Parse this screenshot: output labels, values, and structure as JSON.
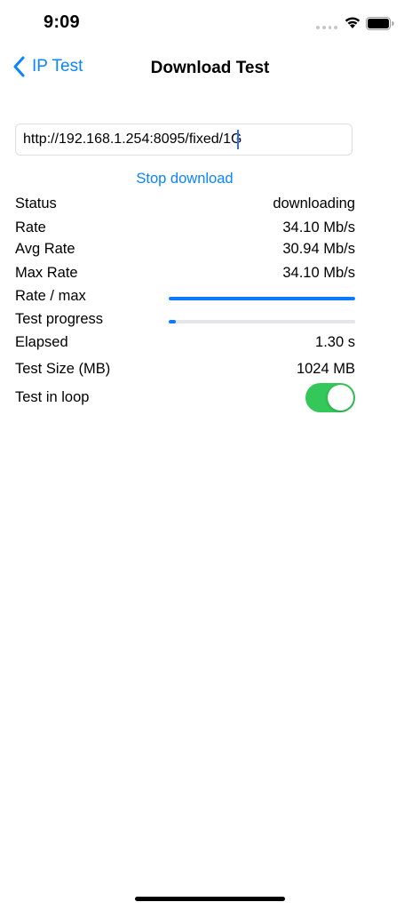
{
  "status_bar": {
    "time": "9:09",
    "icons": [
      "signal-icon",
      "wifi-icon",
      "battery-icon"
    ]
  },
  "nav": {
    "back_label": "IP Test",
    "title": "Download Test"
  },
  "url_field": {
    "value": "http://192.168.1.254:8095/fixed/1G"
  },
  "stop_button_label": "Stop download",
  "rows": {
    "status": {
      "label": "Status",
      "value": "downloading"
    },
    "rate": {
      "label": "Rate",
      "value": "34.10 Mb/s"
    },
    "avg_rate": {
      "label": "Avg Rate",
      "value": "30.94 Mb/s"
    },
    "max_rate": {
      "label": "Max Rate",
      "value": "34.10 Mb/s"
    },
    "rate_max": {
      "label": "Rate / max",
      "progress": 1.0
    },
    "test_progress": {
      "label": "Test progress",
      "progress": 0.04
    },
    "elapsed": {
      "label": "Elapsed",
      "value": "1.30 s"
    },
    "test_size": {
      "label": "Test Size (MB)",
      "value": "1024 MB"
    },
    "test_loop": {
      "label": "Test in loop",
      "on": true
    }
  },
  "colors": {
    "accent": "#0a84ff",
    "progress": "#0a7aff",
    "toggle_on": "#34c759"
  }
}
